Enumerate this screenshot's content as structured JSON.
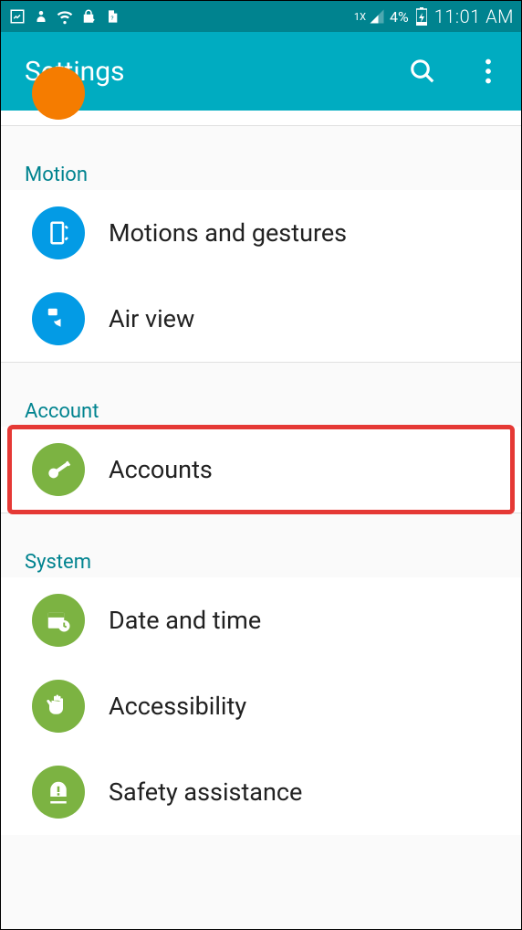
{
  "status_bar": {
    "network_indicator": "1X",
    "battery_pct": "4%",
    "time": "11:01 AM"
  },
  "app_bar": {
    "title": "Settings"
  },
  "sections": {
    "motion": {
      "header": "Motion",
      "items": {
        "motions_gestures": "Motions and gestures",
        "air_view": "Air view"
      }
    },
    "account": {
      "header": "Account",
      "items": {
        "accounts": "Accounts"
      }
    },
    "system": {
      "header": "System",
      "items": {
        "date_time": "Date and time",
        "accessibility": "Accessibility",
        "safety_assistance": "Safety assistance"
      }
    }
  }
}
